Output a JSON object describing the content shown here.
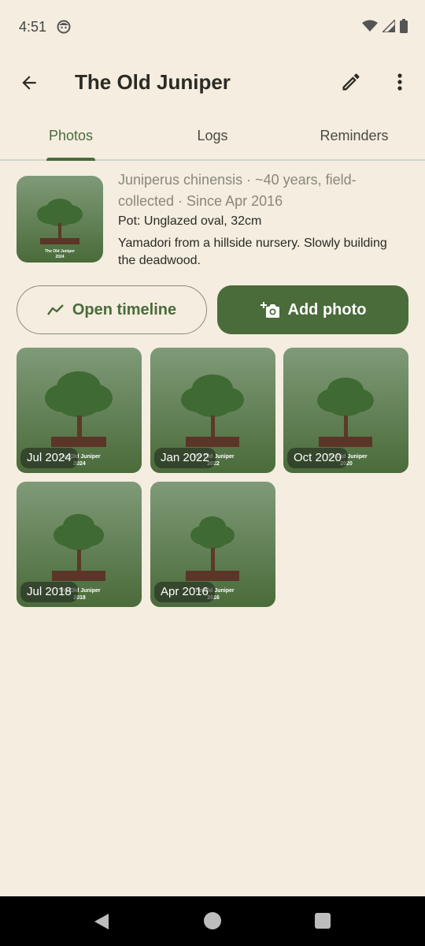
{
  "status_bar": {
    "time": "4:51"
  },
  "app_bar": {
    "title": "The Old Juniper"
  },
  "tabs": [
    {
      "label": "Photos",
      "active": true
    },
    {
      "label": "Logs",
      "active": false
    },
    {
      "label": "Reminders",
      "active": false
    }
  ],
  "header": {
    "species": "Juniperus chinensis · ~40 years, field-collected · Since Apr 2016",
    "pot": "Pot: Unglazed oval, 32cm",
    "notes": "Yamadori from a hillside nursery. Slowly building the deadwood.",
    "thumbnail_caption": {
      "name": "The Old Juniper",
      "year": "2024"
    }
  },
  "actions": {
    "open_timeline_label": "Open timeline",
    "add_photo_label": "Add photo"
  },
  "photos": [
    {
      "label": "Jul 2024",
      "caption_name": "The Old Juniper",
      "caption_year": "2024"
    },
    {
      "label": "Jan 2022",
      "caption_name": "The Old Juniper",
      "caption_year": "2022"
    },
    {
      "label": "Oct 2020",
      "caption_name": "The Old Juniper",
      "caption_year": "2020"
    },
    {
      "label": "Jul 2018",
      "caption_name": "The Old Juniper",
      "caption_year": "2018"
    },
    {
      "label": "Apr 2016",
      "caption_name": "The Old Juniper",
      "caption_year": "2016"
    }
  ],
  "colors": {
    "background": "#f4ede0",
    "accent": "#4a6b3a",
    "text_primary": "#2b2a24",
    "text_secondary": "#8a877c"
  }
}
